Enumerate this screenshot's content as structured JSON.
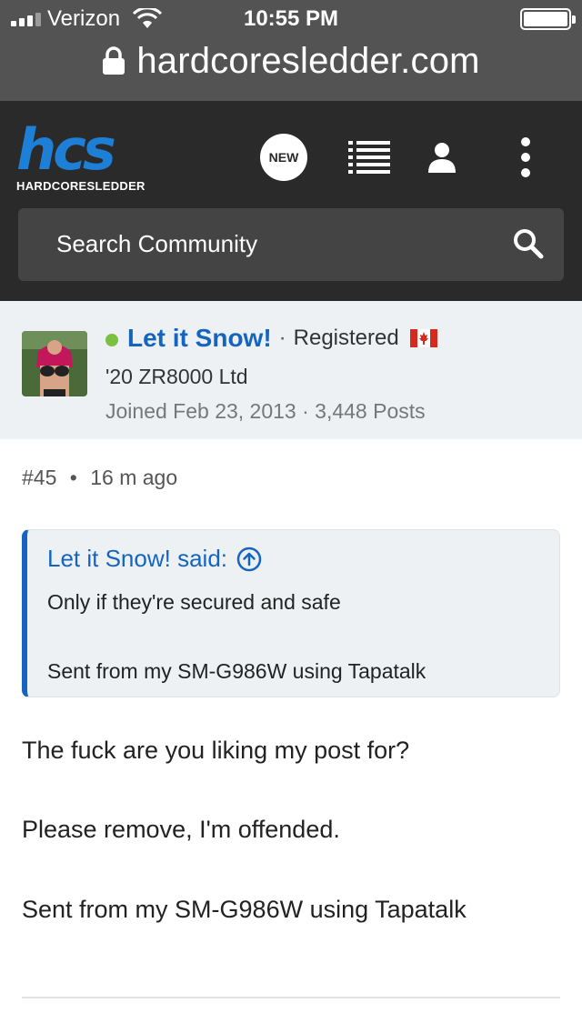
{
  "status_bar": {
    "carrier": "Verizon",
    "time": "10:55 PM"
  },
  "browser": {
    "url": "hardcoresledder.com"
  },
  "header": {
    "logo_mark": "hcs",
    "logo_sub": "HARDCORESLEDDER",
    "new_badge": "NEW",
    "search_placeholder": "Search Community"
  },
  "author": {
    "name": "Let it Snow!",
    "separator": "·",
    "role": "Registered",
    "sled": "'20 ZR8000 Ltd",
    "meta": "Joined Feb 23, 2013 · 3,448 Posts",
    "online_color": "#7ac142"
  },
  "post": {
    "number": "#45",
    "bullet": "•",
    "age": "16 m ago",
    "quote": {
      "author_label": "Let it Snow! said:",
      "line1": "Only if they're secured and safe",
      "line2": "Sent from my SM-G986W using Tapatalk"
    },
    "body": [
      "The fuck are you liking my post for?",
      "Please remove, I'm offended.",
      "Sent from my SM-G986W using Tapatalk"
    ]
  },
  "colors": {
    "link_blue": "#1565c0",
    "header_bg": "#2a2a2a",
    "logo_blue": "#1d7fd6"
  }
}
